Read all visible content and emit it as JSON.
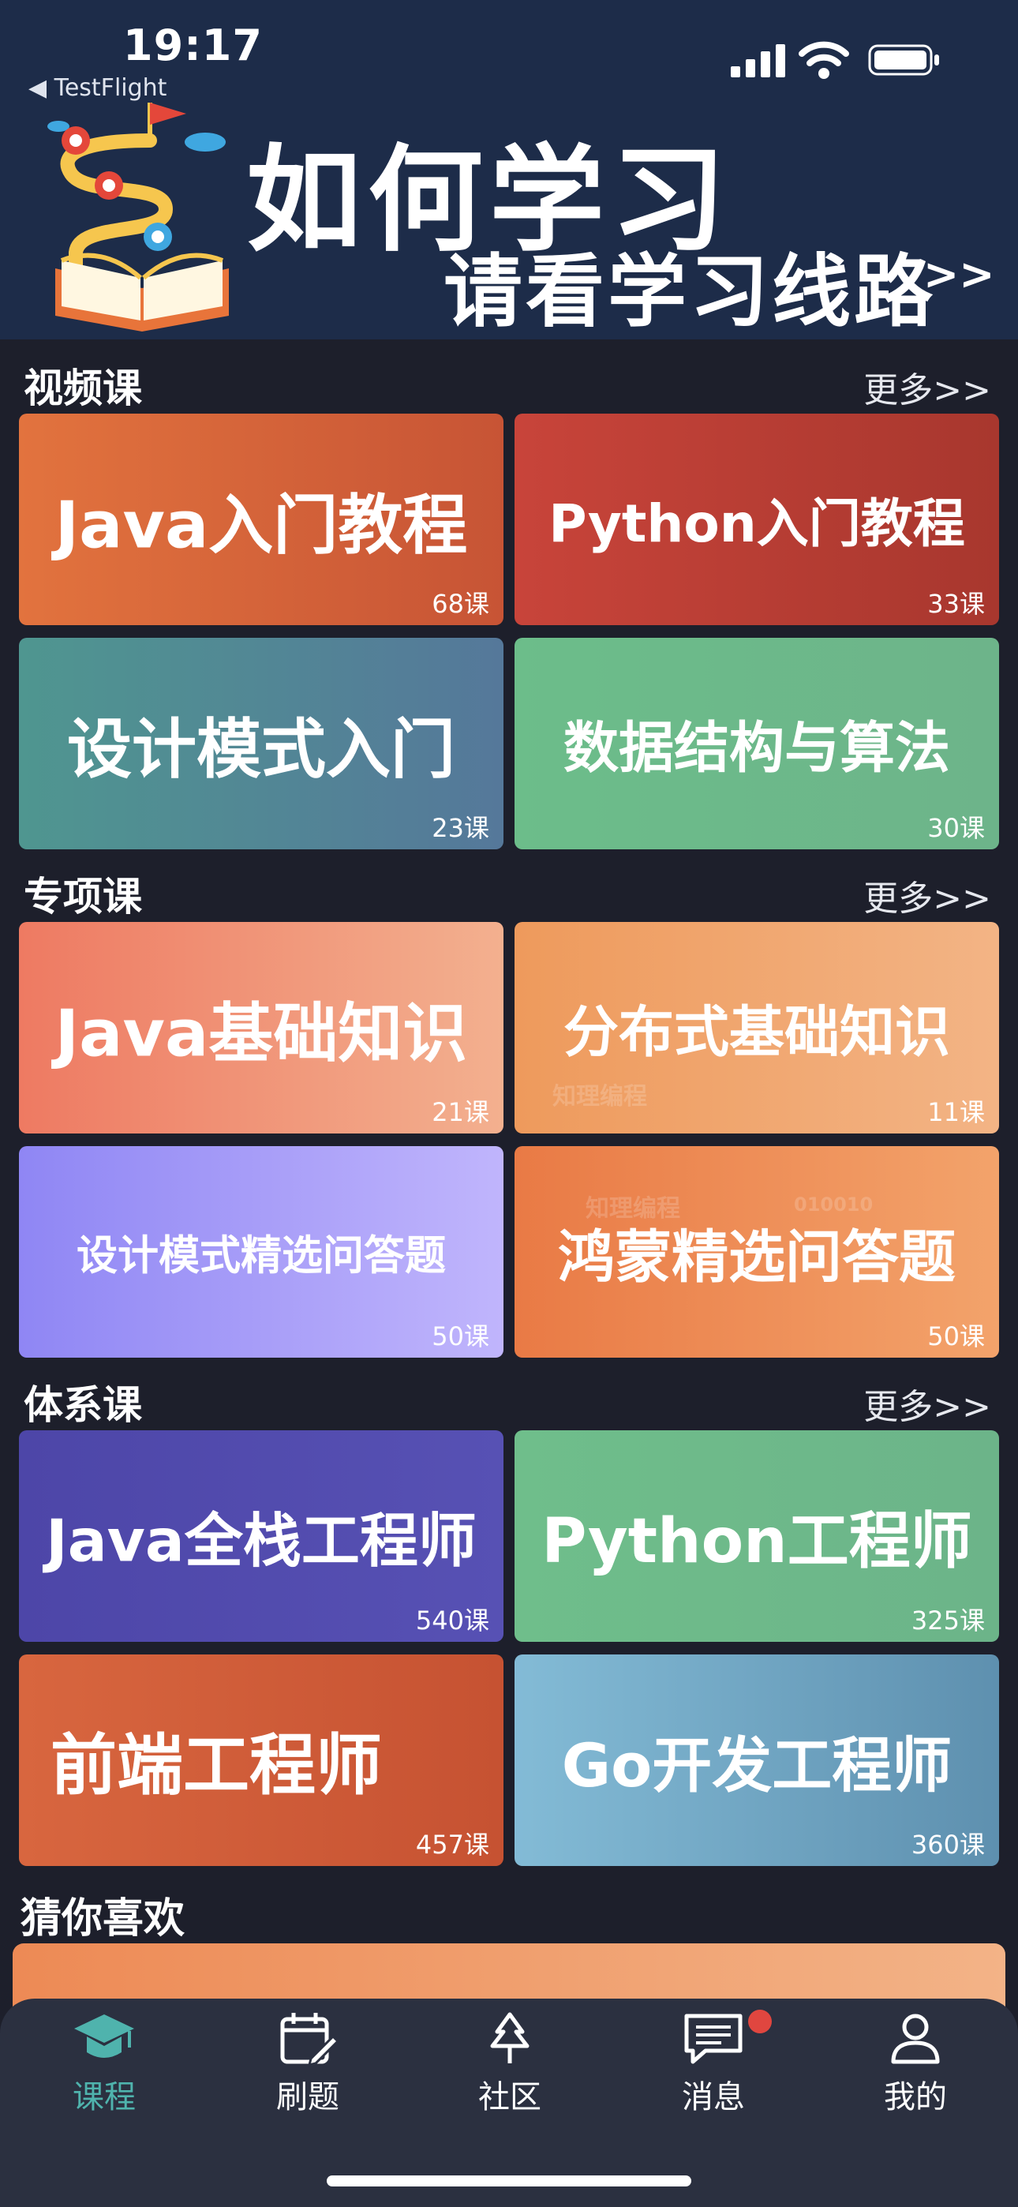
{
  "status": {
    "time": "19:17",
    "back_label": "◀ TestFlight"
  },
  "banner": {
    "title": "如何学习",
    "subtitle": "请看学习线路",
    "arrow": ">>"
  },
  "sections": [
    {
      "title": "视频课",
      "more": "更多>>",
      "cards": [
        {
          "title": "Java入门教程",
          "count": "68课"
        },
        {
          "title": "Python入门教程",
          "count": "33课"
        },
        {
          "title": "设计模式入门",
          "count": "23课"
        },
        {
          "title": "数据结构与算法",
          "count": "30课"
        }
      ]
    },
    {
      "title": "专项课",
      "more": "更多>>",
      "cards": [
        {
          "title": "Java基础知识",
          "count": "21课"
        },
        {
          "title": "分布式基础知识",
          "count": "11课"
        },
        {
          "title": "设计模式精选问答题",
          "count": "50课"
        },
        {
          "title": "鸿蒙精选问答题",
          "count": "50课"
        }
      ]
    },
    {
      "title": "体系课",
      "more": "更多>>",
      "cards": [
        {
          "title": "Java全栈工程师",
          "count": "540课"
        },
        {
          "title": "Python工程师",
          "count": "325课"
        },
        {
          "title": "前端工程师",
          "count": "457课"
        },
        {
          "title": "Go开发工程师",
          "count": "360课"
        }
      ]
    }
  ],
  "watermarks": {
    "brand": "知理编程",
    "binary": "010010"
  },
  "guess": {
    "title": "猜你喜欢"
  },
  "tabs": [
    {
      "label": "课程",
      "icon": "graduation-cap-icon",
      "active": true
    },
    {
      "label": "刷题",
      "icon": "calendar-edit-icon",
      "active": false
    },
    {
      "label": "社区",
      "icon": "tree-icon",
      "active": false
    },
    {
      "label": "消息",
      "icon": "message-icon",
      "active": false
    },
    {
      "label": "我的",
      "icon": "user-icon",
      "active": false
    }
  ],
  "colors": {
    "header_bg": "#1d2c49",
    "page_bg": "#1d1f2b",
    "tabbar_bg": "#2b3040",
    "active_tab": "#4fb3ad",
    "badge": "#e0463f"
  }
}
